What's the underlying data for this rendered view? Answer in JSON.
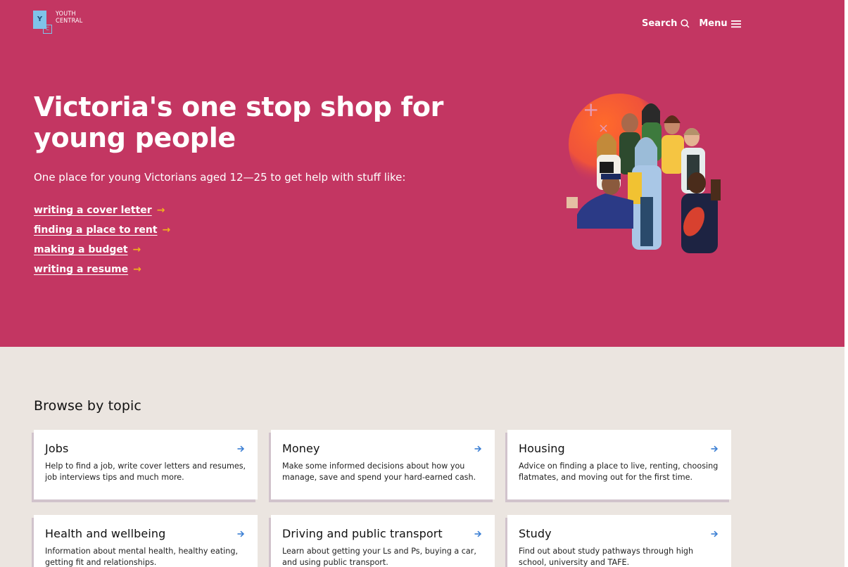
{
  "brand": {
    "logo_letters": [
      "Y",
      "C"
    ],
    "logo_lines": [
      "YOUTH",
      "CENTRAL"
    ]
  },
  "nav": {
    "search_label": "Search",
    "menu_label": "Menu"
  },
  "hero": {
    "title": "Victoria's one stop shop for young people",
    "intro": "One place for young Victorians aged 12—25 to get help with stuff like:",
    "links": [
      {
        "label": "writing a cover letter",
        "arrow": "→"
      },
      {
        "label": "finding a place to rent",
        "arrow": "→"
      },
      {
        "label": "making a budget",
        "arrow": "→"
      },
      {
        "label": "writing a resume",
        "arrow": "→"
      }
    ]
  },
  "browse": {
    "heading": "Browse by topic",
    "topics": [
      {
        "title": "Jobs",
        "desc": "Help to find a job, write cover letters and resumes, job interviews tips and much more."
      },
      {
        "title": "Money",
        "desc": "Make some informed decisions about how you manage, save and spend your hard-earned cash."
      },
      {
        "title": "Housing",
        "desc": "Advice on finding a place to live, renting, choosing flatmates, and moving out for the first time."
      },
      {
        "title": "Health and wellbeing",
        "desc": "Information about mental health, healthy eating, getting fit and relationships."
      },
      {
        "title": "Driving and public transport",
        "desc": "Learn about getting your Ls and Ps, buying a car, and using public transport."
      },
      {
        "title": "Study",
        "desc": "Find out about study pathways through high school, university and TAFE."
      }
    ]
  },
  "colors": {
    "hero_bg": "#c33662",
    "section_bg": "#ebe5e0",
    "link_arrow": "#f2b21c",
    "card_arrow": "#3b7fd4"
  }
}
